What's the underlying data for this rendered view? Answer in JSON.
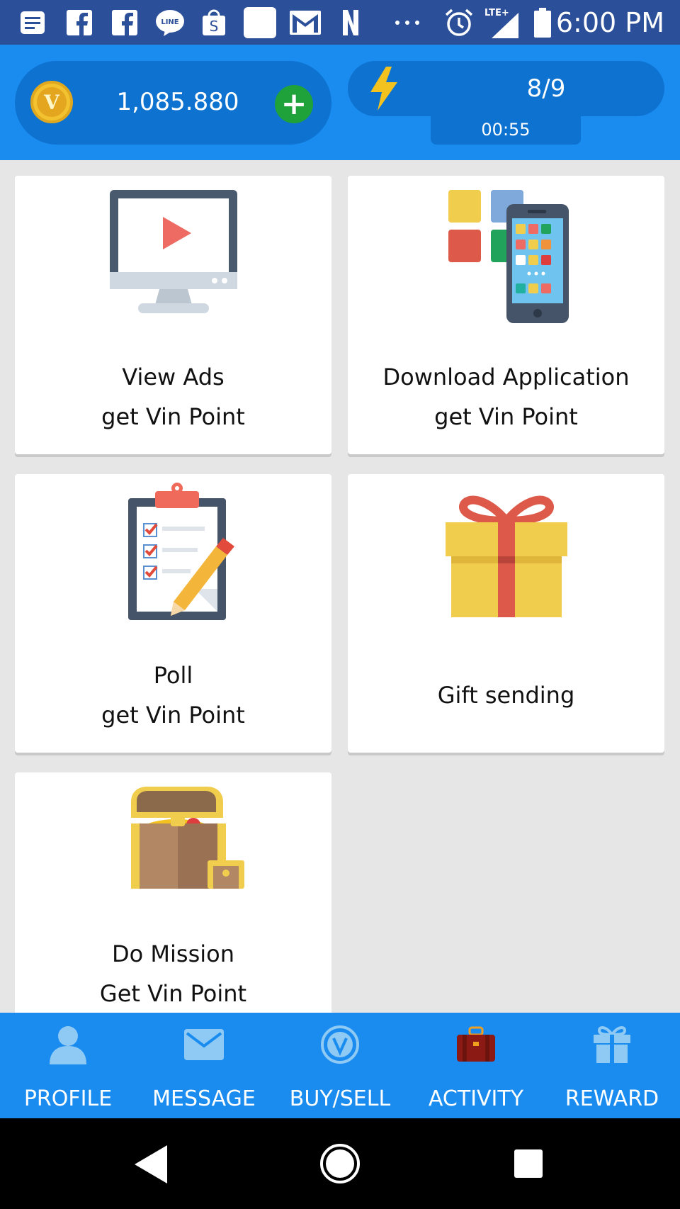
{
  "status_bar": {
    "time": "6:00 PM",
    "network": "LTE+",
    "icons": [
      "notes-icon",
      "facebook-icon",
      "facebook-icon",
      "line-icon",
      "shopee-icon",
      "blank-app-icon",
      "gmail-icon",
      "n-app-icon",
      "more-notifications-icon",
      "alarm-icon",
      "signal-icon",
      "battery-icon"
    ]
  },
  "header": {
    "balance": "1,085.880",
    "coin_letter": "V",
    "add_label": "+",
    "energy": "8/9",
    "timer": "00:55"
  },
  "cards": {
    "view_ads": {
      "line1": "View Ads",
      "line2": "get Vin Point",
      "icon": "monitor-video-icon"
    },
    "download_app": {
      "line1": "Download Application",
      "line2": "get Vin Point",
      "icon": "phone-apps-icon"
    },
    "poll": {
      "line1": "Poll",
      "line2": "get Vin Point",
      "icon": "clipboard-checklist-icon"
    },
    "gift": {
      "line1": "Gift sending",
      "icon": "gift-box-icon"
    },
    "mission": {
      "line1": "Do Mission",
      "line2": "Get Vin Point",
      "icon": "treasure-chest-icon"
    }
  },
  "bottom_nav": {
    "profile": "PROFILE",
    "message": "MESSAGE",
    "buy_sell": "BUY/SELL",
    "activity": "ACTIVITY",
    "reward": "REWARD"
  },
  "colors": {
    "header_blue": "#1a8cf0",
    "pill_blue": "#0e72d0",
    "status_bar": "#2b4f99",
    "nav_icon": "#8fcaf5",
    "activity_icon": "#8b1a14",
    "plus_green": "#1fa23a"
  }
}
